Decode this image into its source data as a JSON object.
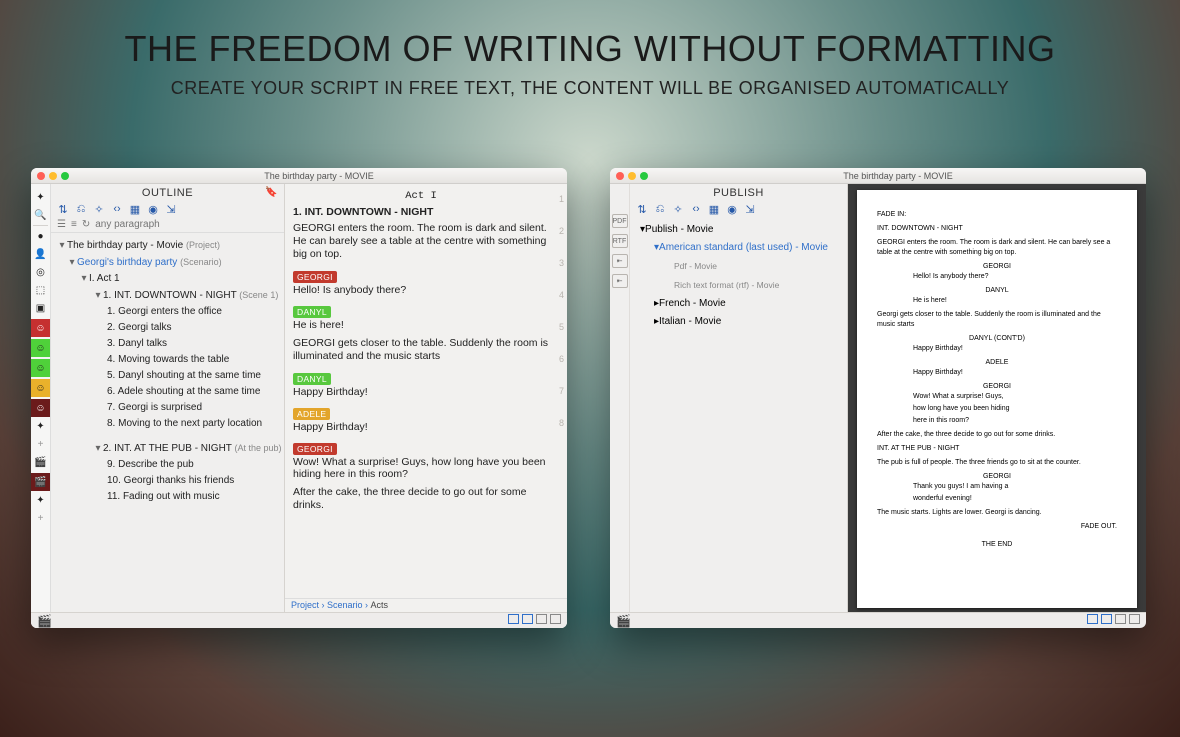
{
  "hero": {
    "title": "THE FREEDOM OF WRITING WITHOUT FORMATTING",
    "subtitle": "CREATE YOUR SCRIPT IN FREE TEXT, THE CONTENT WILL BE ORGANISED AUTOMATICALLY"
  },
  "window_title": "The birthday party - MOVIE",
  "outline": {
    "header": "OUTLINE",
    "filter_placeholder": "any paragraph",
    "project": {
      "title": "The birthday party - Movie",
      "suffix": "(Project)"
    },
    "scenario": {
      "title": "Georgi's birthday party",
      "suffix": "(Scenario)"
    },
    "act1": {
      "title": "I. Act 1"
    },
    "scene1": {
      "title": "1. INT.  DOWNTOWN - NIGHT",
      "suffix": "(Scene 1)"
    },
    "beats1": [
      "1. Georgi enters the office",
      "2. Georgi talks",
      "3. Danyl talks",
      "4. Moving towards the table",
      "5. Danyl shouting at the same time",
      "6. Adele shouting at the same time",
      "7. Georgi is surprised",
      "8. Moving to the next party location"
    ],
    "scene2": {
      "title": "2. INT.  AT THE PUB - NIGHT",
      "suffix": "(At the pub)"
    },
    "beats2": [
      "9. Describe the pub",
      "10. Georgi thanks his friends",
      "11. Fading out with music"
    ]
  },
  "editor": {
    "act_heading": "Act I",
    "slug1": "1. INT.  DOWNTOWN - NIGHT",
    "action1": "GEORGI enters the room. The room is dark and silent. He can barely see a table at the centre with something big on top.",
    "georgi": "GEORGI",
    "georgi_line1": "Hello! Is anybody there?",
    "danyl": "DANYL",
    "danyl_line1": "He is here!",
    "action2": "GEORGI gets closer to the table. Suddenly the room is illuminated and the music starts",
    "danyl_line2": "Happy Birthday!",
    "adele": "ADELE",
    "adele_line1": "Happy Birthday!",
    "georgi_line2": "Wow! What a surprise! Guys, how long have you been hiding here in this room?",
    "action3": "After the cake, the three decide to go out for some drinks.",
    "gutter": [
      "1",
      "2",
      "3",
      "4",
      "5",
      "6",
      "7",
      "8"
    ],
    "crumbs": {
      "a": "Project",
      "b": "Scenario",
      "c": "Acts"
    }
  },
  "publish": {
    "header": "PUBLISH",
    "root": "Publish - Movie",
    "selected": "American standard (last used) - Movie",
    "pdf": "Pdf - Movie",
    "rtf": "Rich text format (rtf) - Movie",
    "french": "French - Movie",
    "italian": "Italian - Movie",
    "rail_labels": {
      "pdf": "PDF",
      "rtf": "RTF"
    }
  },
  "preview": {
    "fadein": "FADE IN:",
    "slug1": "INT. DOWNTOWN - NIGHT",
    "p1": "GEORGI enters the room. The room is dark and silent. He can barely see a table at the centre with something big on top.",
    "ch_georgi": "GEORGI",
    "d1": "Hello! Is anybody there?",
    "ch_danyl": "DANYL",
    "d2": "He is here!",
    "p2": "Georgi gets closer to the table. Suddenly the room is illuminated and the music starts",
    "ch_danyl_contd": "DANYL (CONT'D)",
    "d3": "Happy Birthday!",
    "ch_adele": "ADELE",
    "d4": "Happy Birthday!",
    "d5a": "Wow! What a surprise! Guys,",
    "d5b": "how long have you been hiding",
    "d5c": "here in this room?",
    "p3": "After the cake, the three decide to go out for some drinks.",
    "slug2": "INT. AT THE PUB - NIGHT",
    "p4": "The pub is full of people. The three friends go to sit at the counter.",
    "d6a": "Thank you guys! I am having a",
    "d6b": "wonderful evening!",
    "p5": "The music starts. Lights are lower. Georgi is dancing.",
    "fadeout": "FADE OUT.",
    "end": "THE END"
  }
}
